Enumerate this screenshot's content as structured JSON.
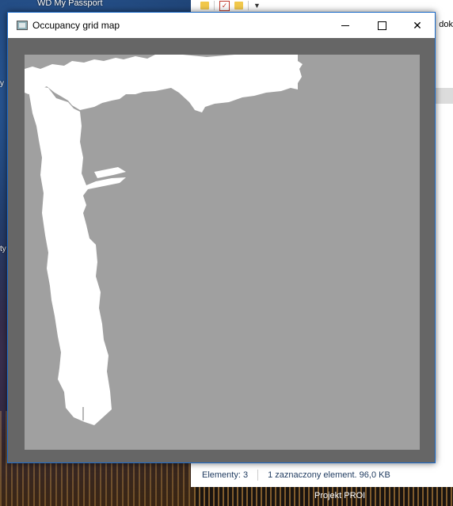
{
  "desktop": {
    "icon_label": "WD My Passport",
    "edge_label_1": "y",
    "edge_label_2": "ty"
  },
  "explorer": {
    "tab_fragment": "dok",
    "status_items": "Elementy: 3",
    "status_selected": "1 zaznaczony element. 96,0 KB"
  },
  "taskbar": {
    "item_label": "Projekt PROI"
  },
  "window": {
    "title": "Occupancy grid map",
    "icon": "app-window-icon"
  },
  "map": {
    "colors": {
      "unknown": "#a0a0a0",
      "free": "#ffffff",
      "frame": "#666666"
    }
  }
}
